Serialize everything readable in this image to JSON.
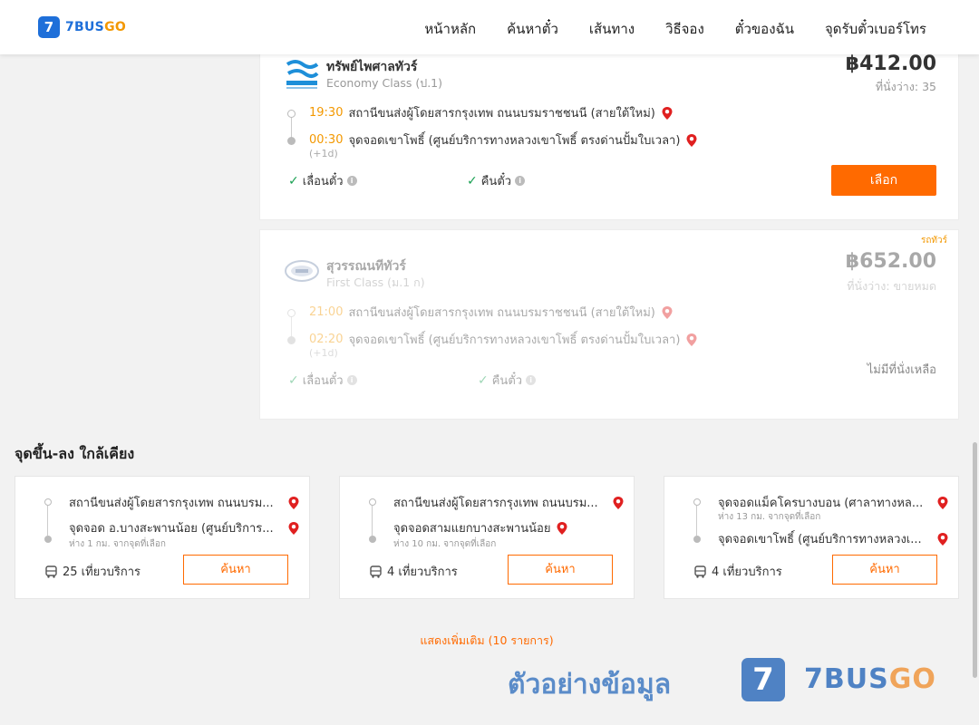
{
  "header": {
    "logo_mark": "7",
    "logo_brand": "7BUS",
    "logo_brand_go": "GO",
    "nav": [
      "หน้าหลัก",
      "ค้นหาตั๋ว",
      "เส้นทาง",
      "วิธีจอง",
      "ตั๋วของฉัน",
      "จุดรับตั๋วเบอร์โทร"
    ]
  },
  "trips": [
    {
      "operator": "ทรัพย์ไพศาลทัวร์",
      "class": "Economy Class (ป.1)",
      "price": "฿412.00",
      "seats": "ที่นั่งว่าง: 35",
      "depart_time": "19:30",
      "depart_stop": "สถานีขนส่งผู้โดยสารกรุงเทพ ถนนบรมราชชนนี (สายใต้ใหม่)",
      "arrive_time": "00:30",
      "arrive_stop": "จุดจอดเขาโพธิ์ (ศูนย์บริการทางหลวงเขาโพธิ์ ตรงด่านปั้มใบเวลา)",
      "day_offset": "(+1d)",
      "feature_change": "เลื่อนตั๋ว",
      "feature_refund": "คืนตั๋ว",
      "select_label": "เลือก"
    },
    {
      "badge": "รถทัวร์",
      "operator": "สุวรรณนทีทัวร์",
      "class": "First Class (ม.1 ก)",
      "price": "฿652.00",
      "seats": "ที่นั่งว่าง: ขายหมด",
      "depart_time": "21:00",
      "depart_stop": "สถานีขนส่งผู้โดยสารกรุงเทพ ถนนบรมราชชนนี (สายใต้ใหม่)",
      "arrive_time": "02:20",
      "arrive_stop": "จุดจอดเขาโพธิ์ (ศูนย์บริการทางหลวงเขาโพธิ์ ตรงด่านปั้มใบเวลา)",
      "day_offset": "(+1d)",
      "feature_change": "เลื่อนตั๋ว",
      "feature_refund": "คืนตั๋ว",
      "status": "ไม่มีที่นั่งเหลือ"
    }
  ],
  "nearby": {
    "title": "จุดขึ้น-ลง ใกล้เคียง",
    "cards": [
      {
        "from": "สถานีขนส่งผู้โดยสารกรุงเทพ ถนนบรม...",
        "from_distance": "",
        "to": "จุดจอด อ.บางสะพานน้อย (ศูนย์บริการ...",
        "to_distance": "ห่าง 1 กม. จากจุดที่เลือก",
        "trips": "25 เที่ยวบริการ",
        "button": "ค้นหา"
      },
      {
        "from": "สถานีขนส่งผู้โดยสารกรุงเทพ ถนนบรม...",
        "from_distance": "",
        "to": "จุดจอดสามแยกบางสะพานน้อย",
        "to_distance": "ห่าง 10 กม. จากจุดที่เลือก",
        "trips": "4 เที่ยวบริการ",
        "button": "ค้นหา"
      },
      {
        "from": "จุดจอดแม็คโครบางบอน (ศาลาทางหล...",
        "from_distance": "ห่าง 13 กม. จากจุดที่เลือก",
        "to": "จุดจอดเขาโพธิ์ (ศูนย์บริการทางหลวงเ...",
        "to_distance": "",
        "trips": "4 เที่ยวบริการ",
        "button": "ค้นหา"
      }
    ],
    "show_more": "แสดงเพิ่มเติม (10 รายการ)"
  },
  "watermark": {
    "text": "ตัวอย่างข้อมูล",
    "mark": "7",
    "brand": "7BUS",
    "brand_go": "GO"
  },
  "colors": {
    "accent": "#ff6a00",
    "brand": "#1e6fd9",
    "time": "#f39800",
    "pin": "#e02020",
    "check": "#1aa053"
  }
}
